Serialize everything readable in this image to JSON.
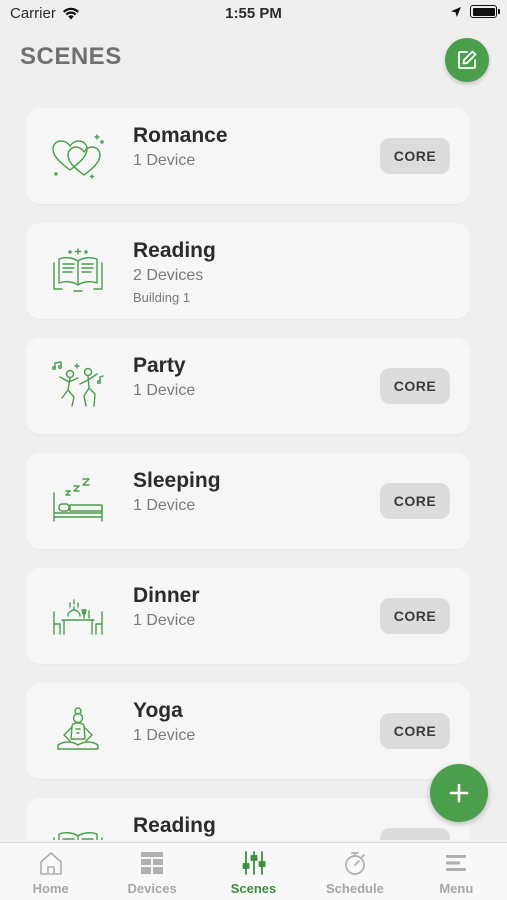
{
  "status_bar": {
    "carrier": "Carrier",
    "time": "1:55 PM"
  },
  "header": {
    "title": "SCENES"
  },
  "scenes": [
    {
      "name": "Romance",
      "count": "1 Device",
      "location": "",
      "badge": "CORE",
      "icon": "hearts-icon"
    },
    {
      "name": "Reading",
      "count": "2 Devices",
      "location": "Building 1",
      "badge": "",
      "icon": "book-icon"
    },
    {
      "name": "Party",
      "count": "1 Device",
      "location": "",
      "badge": "CORE",
      "icon": "dancing-people-icon"
    },
    {
      "name": "Sleeping",
      "count": "1 Device",
      "location": "",
      "badge": "CORE",
      "icon": "bed-icon"
    },
    {
      "name": "Dinner",
      "count": "1 Device",
      "location": "",
      "badge": "CORE",
      "icon": "dinner-table-icon"
    },
    {
      "name": "Yoga",
      "count": "1 Device",
      "location": "",
      "badge": "CORE",
      "icon": "meditation-icon"
    },
    {
      "name": "Reading",
      "count": "",
      "location": "",
      "badge": "",
      "icon": "book-icon"
    }
  ],
  "tabs": [
    {
      "label": "Home",
      "icon": "home-icon",
      "active": false
    },
    {
      "label": "Devices",
      "icon": "grid-icon",
      "active": false
    },
    {
      "label": "Scenes",
      "icon": "sliders-icon",
      "active": true
    },
    {
      "label": "Schedule",
      "icon": "stopwatch-icon",
      "active": false
    },
    {
      "label": "Menu",
      "icon": "menu-icon",
      "active": false
    }
  ],
  "colors": {
    "accent": "#4a9e4c",
    "active_tab": "#3c8f3e",
    "background": "#efefef",
    "card": "#f6f6f6"
  }
}
